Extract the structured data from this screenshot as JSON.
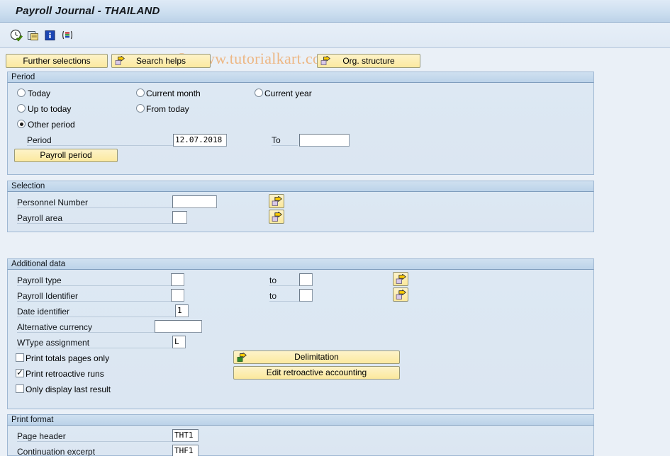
{
  "window": {
    "title": "Payroll Journal - THAILAND"
  },
  "watermark": {
    "text": "© www.tutorialkart.com"
  },
  "toolbar": {
    "icons": [
      {
        "name": "execute-clock-icon",
        "title": "Execute"
      },
      {
        "name": "execute-background-icon",
        "title": "Execute in background"
      },
      {
        "name": "info-icon",
        "title": "Information"
      },
      {
        "name": "variant-icon",
        "title": "Get variant"
      }
    ]
  },
  "actions": {
    "further_selections": "Further selections",
    "search_helps": "Search helps",
    "org_structure": "Org. structure"
  },
  "period": {
    "header": "Period",
    "options": [
      {
        "label": "Today",
        "selected": false
      },
      {
        "label": "Current month",
        "selected": false
      },
      {
        "label": "Current year",
        "selected": false
      },
      {
        "label": "Up to today",
        "selected": false
      },
      {
        "label": "From today",
        "selected": false
      },
      {
        "label": "Other period",
        "selected": true
      }
    ],
    "period_label": "Period",
    "period_value": "12.07.2018",
    "to_label": "To",
    "to_value": "",
    "payroll_period_button": "Payroll period"
  },
  "selection": {
    "header": "Selection",
    "personnel_number_label": "Personnel Number",
    "personnel_number_value": "",
    "payroll_area_label": "Payroll area",
    "payroll_area_value": ""
  },
  "additional": {
    "header": "Additional data",
    "payroll_type_label": "Payroll type",
    "payroll_type_value": "",
    "payroll_type_to_label": "to",
    "payroll_type_to_value": "",
    "payroll_identifier_label": "Payroll Identifier",
    "payroll_identifier_value": "",
    "payroll_identifier_to_label": "to",
    "payroll_identifier_to_value": "",
    "date_identifier_label": "Date identifier",
    "date_identifier_value": "1",
    "alternative_currency_label": "Alternative currency",
    "alternative_currency_value": "",
    "wtype_assignment_label": "WType assignment",
    "wtype_assignment_value": "L",
    "print_totals_label": "Print totals pages only",
    "print_totals_checked": false,
    "print_retroactive_label": "Print retroactive runs",
    "print_retroactive_checked": true,
    "only_last_result_label": "Only display last result",
    "only_last_result_checked": false,
    "delimitation_button": "Delimitation",
    "edit_retroactive_button": "Edit retroactive accounting"
  },
  "print_format": {
    "header": "Print format",
    "page_header_label": "Page header",
    "page_header_value": "THT1",
    "continuation_label": "Continuation excerpt",
    "continuation_value": "THF1"
  },
  "colors": {
    "title_bar": "#cddff0",
    "panel_bg": "#dde8f3",
    "panel_header": "#bcd3e9",
    "button_yellow": "#fce99f",
    "watermark": "#edb784",
    "page_bg": "#eaf0f7"
  }
}
